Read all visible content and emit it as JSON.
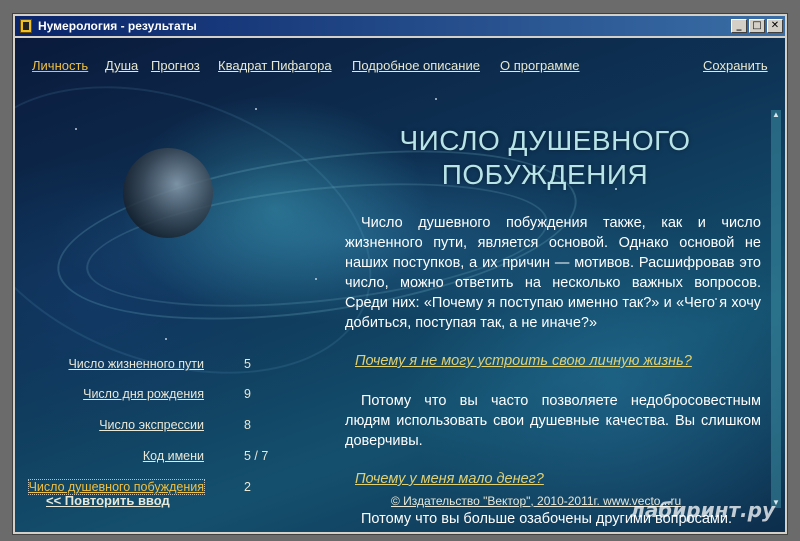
{
  "window": {
    "title": "Нумерология - результаты",
    "minimize_label": "_",
    "maximize_label": "□",
    "close_label": "✕"
  },
  "nav": {
    "items": [
      {
        "label": "Личность",
        "active": true
      },
      {
        "label": "Душа",
        "active": false
      },
      {
        "label": "Прогноз",
        "active": false
      },
      {
        "label": "Квадрат Пифагора",
        "active": false
      },
      {
        "label": "Подробное описание",
        "active": false
      },
      {
        "label": "О программе",
        "active": false
      }
    ],
    "save_label": "Сохранить"
  },
  "heading": {
    "line1": "ЧИСЛО ДУШЕВНОГО",
    "line2": "ПОБУЖДЕНИЯ"
  },
  "content": {
    "intro": "Число душевного побуждения также, как и число жизненного пути, является основой. Однако основой не наших поступков, а их причин — мотивов. Расшифровав это число, можно ответить на несколько важных вопросов. Среди них: «Почему я поступаю именно так?» и «Чего я хочу добиться, поступая так, а не иначе?»",
    "q1": "Почему я не могу устроить свою личную жизнь?",
    "a1": "Потому что вы часто позволяете недобросовестным людям использовать свои душевные качества. Вы слишком доверчивы.",
    "q2": "Почему у меня мало денег?",
    "a2": "Потому что вы больше озабочены другими вопросами."
  },
  "left_list": [
    {
      "label": "Число жизненного пути",
      "value": "5",
      "active": false
    },
    {
      "label": "Число дня рождения",
      "value": "9",
      "active": false
    },
    {
      "label": "Число экспрессии",
      "value": "8",
      "active": false
    },
    {
      "label": "Код имени",
      "value": "5 / 7",
      "active": false
    },
    {
      "label": "Число душевного побуждения",
      "value": "2",
      "active": true
    }
  ],
  "footer": {
    "back_label": "<< Повторить ввод",
    "copyright": "© Издательство \"Вектор\", 2010-2011г. www.vecto...ru"
  },
  "watermark": "лабиринт.ру"
}
